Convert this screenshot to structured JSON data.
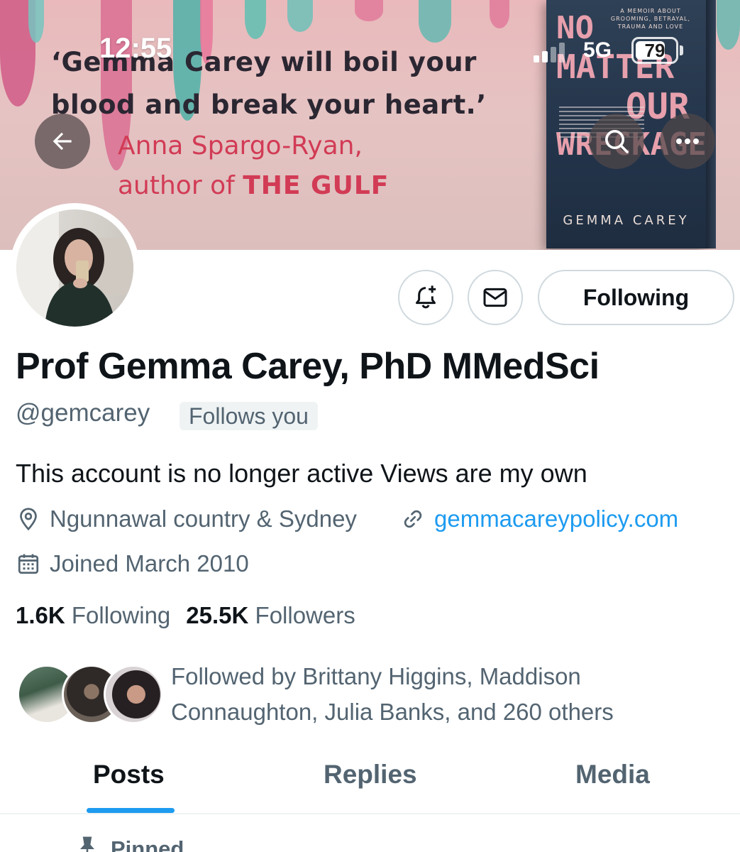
{
  "status_bar": {
    "time": "12:55",
    "network": "5G",
    "battery": "79",
    "battery_level": 0.79
  },
  "banner": {
    "quote": "‘Gemma Carey will boil your blood and break your heart.’",
    "quote_author": "Anna Spargo-Ryan,",
    "quote_author_line2_prefix": "author of ",
    "quote_author_line2_title": "THE GULF",
    "book": {
      "subtitle": "A MEMOIR ABOUT GROOMING, BETRAYAL, TRAUMA AND LOVE",
      "title_lines": [
        "No",
        "Matter",
        "Our",
        "Wreckage"
      ],
      "author": "GEMMA CAREY"
    }
  },
  "nav": {
    "back_icon": "arrow-left-icon",
    "search_icon": "search-icon",
    "more_icon": "more-horizontal-icon"
  },
  "actions": {
    "notify_icon": "bell-plus-icon",
    "message_icon": "envelope-icon",
    "following_label": "Following"
  },
  "profile": {
    "display_name": "Prof Gemma Carey, PhD MMedSci",
    "handle": "@gemcarey",
    "follows_you": "Follows you",
    "bio": "This account is no longer active Views are my own",
    "location": "Ngunnawal country & Sydney",
    "website": "gemmacareypolicy.com",
    "joined": "Joined March 2010",
    "following_count": "1.6K",
    "following_label": "Following",
    "followers_count": "25.5K",
    "followers_label": "Followers",
    "followed_by": "Followed by Brittany Higgins, Maddison Connaughton, Julia Banks, and 260 others"
  },
  "tabs": [
    {
      "label": "Posts",
      "active": true
    },
    {
      "label": "Replies",
      "active": false
    },
    {
      "label": "Media",
      "active": false
    }
  ],
  "pinned_label": "Pinned",
  "colors": {
    "accent": "#1d9bf0",
    "text_primary": "#0f1419",
    "text_secondary": "#536471",
    "border": "#cfd9de",
    "quote_author": "#d23b55"
  }
}
